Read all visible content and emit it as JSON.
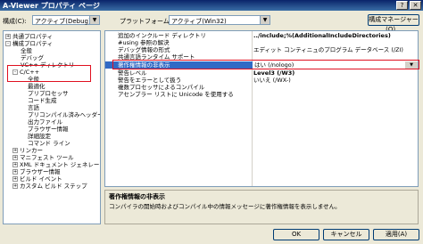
{
  "window": {
    "title": "A-Viewer プロパティ ページ",
    "close_label": "✕",
    "help_label": "?"
  },
  "toolbar": {
    "config_label": "構成(C):",
    "config_value": "アクティブ(Debug)",
    "platform_label": "プラットフォーム(P):",
    "platform_value": "アクティブ(Win32)",
    "config_manager_label": "構成マネージャー(O)..."
  },
  "tree": {
    "items": [
      {
        "label": "共通プロパティ",
        "expander": "+"
      },
      {
        "label": "構成プロパティ",
        "expander": "-"
      },
      {
        "label": "全般"
      },
      {
        "label": "デバッグ"
      },
      {
        "label": "VC++ ディレクトリ"
      },
      {
        "label": "C/C++",
        "expander": "-"
      },
      {
        "label": "全般"
      },
      {
        "label": "最適化"
      },
      {
        "label": "プリプロセッサ"
      },
      {
        "label": "コード生成"
      },
      {
        "label": "言語"
      },
      {
        "label": "プリコンパイル済みヘッダー"
      },
      {
        "label": "出力ファイル"
      },
      {
        "label": "ブラウザー情報"
      },
      {
        "label": "詳細設定"
      },
      {
        "label": "コマンド ライン"
      },
      {
        "label": "リンカー",
        "expander": "+"
      },
      {
        "label": "マニフェスト ツール",
        "expander": "+"
      },
      {
        "label": "XML ドキュメント ジェネレーター",
        "expander": "+"
      },
      {
        "label": "ブラウザー情報",
        "expander": "+"
      },
      {
        "label": "ビルド イベント",
        "expander": "+"
      },
      {
        "label": "カスタム ビルド ステップ",
        "expander": "+"
      }
    ]
  },
  "grid": {
    "rows": [
      {
        "name": "追加のインクルード ディレクトリ",
        "value": "../include;%(AdditionalIncludeDirectories)"
      },
      {
        "name": "#using 参照の解決",
        "value": ""
      },
      {
        "name": "デバッグ情報の形式",
        "value": "エディット コンティニュのプログラム データベース (/ZI)"
      },
      {
        "name": "共通言語ランタイム サポート",
        "value": ""
      },
      {
        "name": "著作権情報の非表示",
        "value": "はい (/nologo)"
      },
      {
        "name": "警告レベル",
        "value": "Level3 (/W3)"
      },
      {
        "name": "警告をエラーとして扱う",
        "value": "いいえ (/WX-)"
      },
      {
        "name": "複数プロセッサによるコンパイル",
        "value": ""
      },
      {
        "name": "アセンブラー リストに Unicode を使用する",
        "value": ""
      }
    ]
  },
  "description": {
    "title": "著作権情報の非表示",
    "text": "コンパイラの開始時およびコンパイル中の情報メッセージに著作権情報を表示しません。"
  },
  "buttons": {
    "ok": "OK",
    "cancel": "キャンセル",
    "apply": "適用(A)"
  }
}
